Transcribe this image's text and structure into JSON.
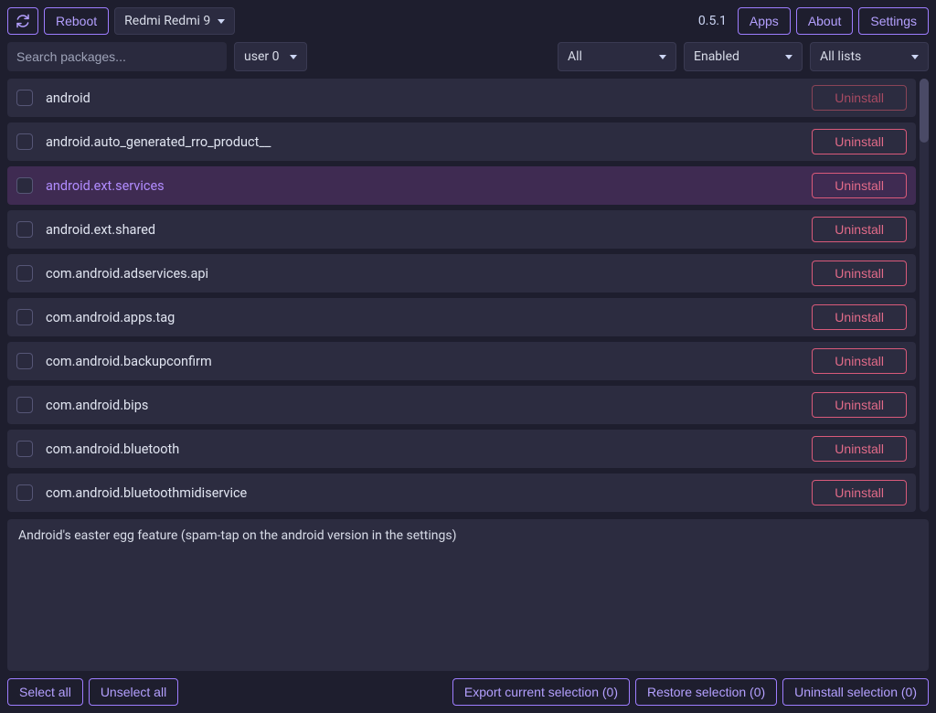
{
  "header": {
    "reboot_label": "Reboot",
    "device": "Redmi Redmi 9",
    "version": "0.5.1",
    "apps_label": "Apps",
    "about_label": "About",
    "settings_label": "Settings"
  },
  "filters": {
    "search_placeholder": "Search packages...",
    "user_label": "user 0",
    "type_label": "All",
    "status_label": "Enabled",
    "lists_label": "All lists"
  },
  "packages": [
    {
      "name": "android",
      "action": "Uninstall",
      "dim": true,
      "selected": false
    },
    {
      "name": "android.auto_generated_rro_product__",
      "action": "Uninstall",
      "dim": false,
      "selected": false
    },
    {
      "name": "android.ext.services",
      "action": "Uninstall",
      "dim": false,
      "selected": true
    },
    {
      "name": "android.ext.shared",
      "action": "Uninstall",
      "dim": false,
      "selected": false
    },
    {
      "name": "com.android.adservices.api",
      "action": "Uninstall",
      "dim": false,
      "selected": false
    },
    {
      "name": "com.android.apps.tag",
      "action": "Uninstall",
      "dim": false,
      "selected": false
    },
    {
      "name": "com.android.backupconfirm",
      "action": "Uninstall",
      "dim": false,
      "selected": false
    },
    {
      "name": "com.android.bips",
      "action": "Uninstall",
      "dim": false,
      "selected": false
    },
    {
      "name": "com.android.bluetooth",
      "action": "Uninstall",
      "dim": false,
      "selected": false
    },
    {
      "name": "com.android.bluetoothmidiservice",
      "action": "Uninstall",
      "dim": false,
      "selected": false
    }
  ],
  "description": "Android's easter egg feature (spam-tap on the android version in the settings)",
  "footer": {
    "select_all": "Select all",
    "unselect_all": "Unselect all",
    "export": "Export current selection (0)",
    "restore": "Restore selection (0)",
    "uninstall": "Uninstall selection (0)"
  }
}
